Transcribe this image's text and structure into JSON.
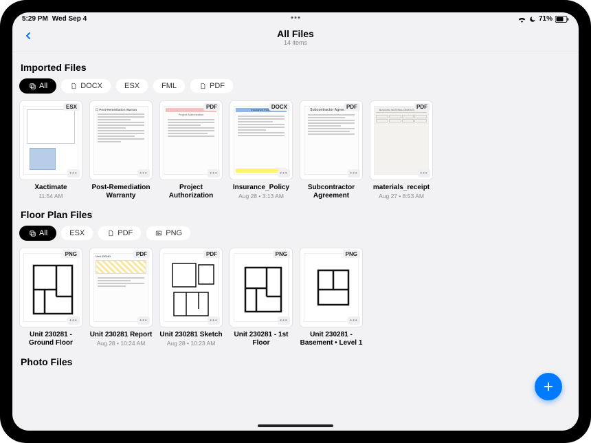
{
  "status": {
    "time": "5:29 PM",
    "date": "Wed Sep 4",
    "battery": "71%",
    "wifi_icon": "wifi",
    "moon_icon": "moon",
    "battery_icon": "battery"
  },
  "nav": {
    "title": "All Files",
    "subtitle": "14 items",
    "back_icon": "chevron-left"
  },
  "sections": {
    "imported": {
      "title": "Imported Files",
      "filters": [
        {
          "label": "All",
          "active": true,
          "icon": "stack"
        },
        {
          "label": "DOCX",
          "active": false,
          "icon": "doc"
        },
        {
          "label": "ESX",
          "active": false,
          "icon": null
        },
        {
          "label": "FML",
          "active": false,
          "icon": null
        },
        {
          "label": "PDF",
          "active": false,
          "icon": "doc"
        }
      ],
      "files": [
        {
          "title": "Xactimate",
          "meta": "11:54 AM",
          "badge": "ESX",
          "thumb": "floorplan-blue"
        },
        {
          "title": "Post-Remediation Warranty",
          "meta": "",
          "badge": "",
          "thumb": "doc-plain"
        },
        {
          "title": "Project Authorization",
          "meta": "",
          "badge": "PDF",
          "thumb": "doc-red-header"
        },
        {
          "title": "Insurance_Policy",
          "meta": "Aug 28 • 3:13 AM",
          "badge": "DOCX",
          "thumb": "doc-blue-header"
        },
        {
          "title": "Subcontractor Agreement",
          "meta": "",
          "badge": "PDF",
          "thumb": "doc-agreement"
        },
        {
          "title": "materials_receipt",
          "meta": "Aug 27 • 8:53 AM",
          "badge": "PDF",
          "thumb": "doc-receipt"
        }
      ]
    },
    "floorplans": {
      "title": "Floor Plan Files",
      "filters": [
        {
          "label": "All",
          "active": true,
          "icon": "stack"
        },
        {
          "label": "ESX",
          "active": false,
          "icon": null
        },
        {
          "label": "PDF",
          "active": false,
          "icon": "doc"
        },
        {
          "label": "PNG",
          "active": false,
          "icon": "image"
        }
      ],
      "files": [
        {
          "title": "Unit 230281 - Ground Floor",
          "meta": "",
          "badge": "PNG",
          "thumb": "fp1"
        },
        {
          "title": "Unit 230281 Report",
          "meta": "Aug 28 • 10:24 AM",
          "badge": "PDF",
          "thumb": "doc-report"
        },
        {
          "title": "Unit 230281 Sketch",
          "meta": "Aug 28 • 10:23 AM",
          "badge": "PDF",
          "thumb": "fp2"
        },
        {
          "title": "Unit 230281 - 1st Floor",
          "meta": "",
          "badge": "PNG",
          "thumb": "fp3"
        },
        {
          "title": "Unit 230281 - Basement • Level 1",
          "meta": "",
          "badge": "PNG",
          "thumb": "fp4"
        }
      ]
    },
    "photos": {
      "title": "Photo Files"
    }
  },
  "fab": {
    "icon": "plus"
  }
}
